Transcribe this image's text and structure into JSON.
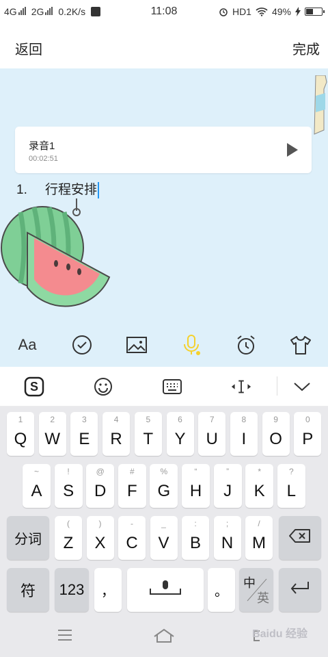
{
  "status_bar": {
    "net1": "4G",
    "net2": "2G",
    "speed": "0.2K/s",
    "time": "11:08",
    "hd": "HD1",
    "battery": "49%",
    "battery_level": 0.49
  },
  "nav": {
    "back_label": "返回",
    "done_label": "完成"
  },
  "recording": {
    "title": "录音1",
    "duration": "00:02:51"
  },
  "content": {
    "list_number": "1.",
    "line_text": "行程安排"
  },
  "toolbar": {
    "icons": [
      "font-icon",
      "check-circle-icon",
      "image-icon",
      "microphone-icon",
      "alarm-icon",
      "tshirt-icon"
    ],
    "font_label": "Aa",
    "accent_color": "#f5d12c"
  },
  "keyboard": {
    "row1": [
      {
        "hint": "1",
        "key": "Q"
      },
      {
        "hint": "2",
        "key": "W"
      },
      {
        "hint": "3",
        "key": "E"
      },
      {
        "hint": "4",
        "key": "R"
      },
      {
        "hint": "5",
        "key": "T"
      },
      {
        "hint": "6",
        "key": "Y"
      },
      {
        "hint": "7",
        "key": "U"
      },
      {
        "hint": "8",
        "key": "I"
      },
      {
        "hint": "9",
        "key": "O"
      },
      {
        "hint": "0",
        "key": "P"
      }
    ],
    "row2": [
      {
        "hint": "~",
        "key": "A"
      },
      {
        "hint": "!",
        "key": "S"
      },
      {
        "hint": "@",
        "key": "D"
      },
      {
        "hint": "#",
        "key": "F"
      },
      {
        "hint": "%",
        "key": "G"
      },
      {
        "hint": "“",
        "key": "H"
      },
      {
        "hint": "”",
        "key": "J"
      },
      {
        "hint": "*",
        "key": "K"
      },
      {
        "hint": "?",
        "key": "L"
      }
    ],
    "row3": [
      {
        "hint": "(",
        "key": "Z"
      },
      {
        "hint": ")",
        "key": "X"
      },
      {
        "hint": "-",
        "key": "C"
      },
      {
        "hint": "_",
        "key": "V"
      },
      {
        "hint": ":",
        "key": "B"
      },
      {
        "hint": ";",
        "key": "N"
      },
      {
        "hint": "/",
        "key": "M"
      }
    ],
    "fenci_label": "分词",
    "symbol_label": "符",
    "num_label": "123",
    "comma_label": "，",
    "period_label": "。",
    "lang_top": "中",
    "lang_bottom": "英"
  },
  "watermark": "Baidu 经验"
}
